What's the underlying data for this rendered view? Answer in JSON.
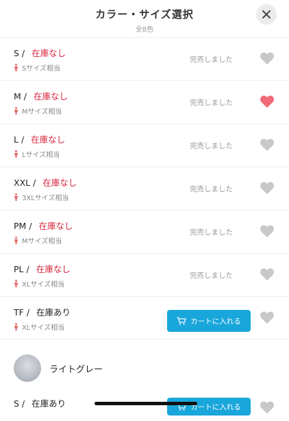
{
  "header": {
    "title": "カラー・サイズ選択",
    "subtitle": "全8色"
  },
  "colors": {
    "stock_out": "#d7263d",
    "cart_button": "#19a6db",
    "heart_active": "#f06a78",
    "heart_inactive": "#c8c8c8"
  },
  "rows": [
    {
      "size": "S",
      "separator": "/",
      "stock": "在庫なし",
      "fit": "Sサイズ相当",
      "status": "完売しました",
      "favorited": false
    },
    {
      "size": "M",
      "separator": "/",
      "stock": "在庫なし",
      "fit": "Mサイズ相当",
      "status": "完売しました",
      "favorited": true
    },
    {
      "size": "L",
      "separator": "/",
      "stock": "在庫なし",
      "fit": "Lサイズ相当",
      "status": "完売しました",
      "favorited": false
    },
    {
      "size": "XXL",
      "separator": "/",
      "stock": "在庫なし",
      "fit": "3XLサイズ相当",
      "status": "完売しました",
      "favorited": false
    },
    {
      "size": "PM",
      "separator": "/",
      "stock": "在庫なし",
      "fit": "Mサイズ相当",
      "status": "完売しました",
      "favorited": false
    },
    {
      "size": "PL",
      "separator": "/",
      "stock": "在庫なし",
      "fit": "XLサイズ相当",
      "status": "完売しました",
      "favorited": false
    },
    {
      "size": "TF",
      "separator": "/",
      "stock": "在庫あり",
      "fit": "XLサイズ相当",
      "cart_label": "カートに入れる",
      "favorited": false
    }
  ],
  "color_option": {
    "name": "ライトグレー"
  },
  "next_row": {
    "size": "S",
    "separator": "/",
    "stock": "在庫あり",
    "cart_label": "カートに入れる"
  }
}
